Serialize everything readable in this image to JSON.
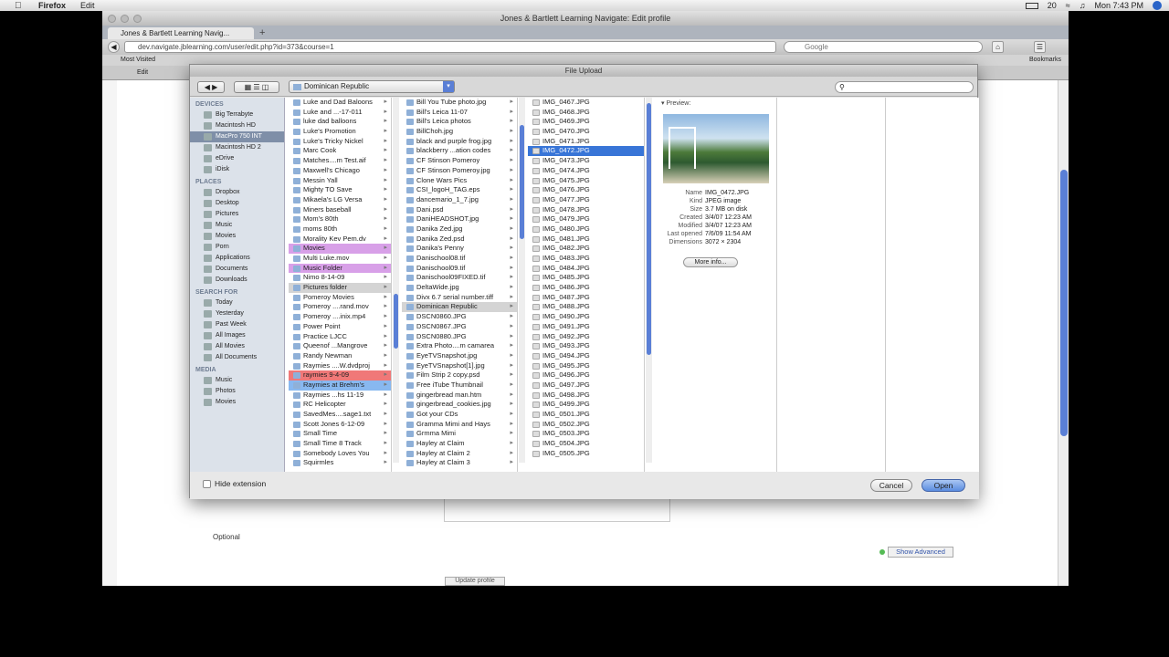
{
  "menubar": {
    "app": "Firefox",
    "items": [
      "Edit"
    ],
    "battery": "20",
    "clock": "Mon 7:43 PM"
  },
  "browser": {
    "window_title": "Jones & Bartlett Learning Navigate: Edit profile",
    "tab_title": "Jones & Bartlett Learning Navig...",
    "url": "dev.navigate.jblearning.com/user/edit.php?id=373&course=1",
    "search_placeholder": "Google",
    "bookmarks_bar": {
      "most_visited": "Most Visited",
      "bookmarks": "Bookmarks"
    },
    "toolbar2": {
      "edit": "Edit"
    }
  },
  "dialog": {
    "title": "File Upload",
    "path": "Dominican Republic",
    "search_value": "",
    "sidebar": {
      "devices_head": "DEVICES",
      "devices": [
        "Big Terrabyte",
        "Macintosh HD",
        "MacPro 750 INT",
        "Macintosh HD 2",
        "eDrive",
        "iDisk"
      ],
      "places_head": "PLACES",
      "places": [
        "Dropbox",
        "Desktop",
        "Pictures",
        "Music",
        "Movies",
        "Porn",
        "Applications",
        "Documents",
        "Downloads"
      ],
      "search_head": "SEARCH FOR",
      "search": [
        "Today",
        "Yesterday",
        "Past Week",
        "All Images",
        "All Movies",
        "All Documents"
      ],
      "media_head": "MEDIA",
      "media": [
        "Music",
        "Photos",
        "Movies"
      ]
    },
    "col1": [
      "Luke and Dad Baloons",
      "Luke and ...-17-011",
      "luke dad balloons",
      "Luke's Promotion",
      "Luke's Tricky Nickel",
      "Marc Cook",
      "Matches....m Test.aif",
      "Maxwell's Chicago",
      "Messin Yall",
      "Mighty TO Save",
      "Mikaela's LG Versa",
      "Miners baseball",
      "Mom's 80th",
      "moms 80th",
      "Morality Kev Pem.dv",
      "Movies",
      "Multi Luke.mov",
      "Music Folder",
      "Nimo 8-14-09",
      "Pictures folder",
      "Pomeroy Movies",
      "Pomeroy ....rand.mov",
      "Pomeroy ....inix.mp4",
      "Power Point",
      "Practice LJCC",
      "Queenof ...Mangrove",
      "Randy Newman",
      "Raymies ....W.dvdproj",
      "raymies 9-4-09",
      "Raymies at Brehm's",
      "Raymies ...hs 11-19",
      "RC Helicopter",
      "SavedMes....sage1.txt",
      "Scott Jones 6-12-09",
      "Small Time",
      "Small Time 8 Track",
      "Somebody Loves You",
      "Squirmles"
    ],
    "col2": [
      "Bill You Tube photo.jpg",
      "Bill's Leica 11-07",
      "Bill's Leica photos",
      "BillChoh.jpg",
      "black and purple frog.jpg",
      "blackberry ...ation codes",
      "CF Stinson Pomeroy",
      "CF Stinson Pomeroy.jpg",
      "Clone Wars Pics",
      "CSI_logoH_TAG.eps",
      "dancemario_1_7.jpg",
      "Dani.psd",
      "DaniHEADSHOT.jpg",
      "Danika Zed.jpg",
      "Danika Zed.psd",
      "Danika's Penny",
      "Danischool08.tif",
      "Danischool09.tif",
      "Danischool09FIXED.tif",
      "DeltaWide.jpg",
      "Divx 6.7 serial number.tiff",
      "Dominican Republic",
      "DSCN0860.JPG",
      "DSCN0867.JPG",
      "DSCN0880.JPG",
      "Extra Photo....m camarea",
      "EyeTVSnapshot.jpg",
      "EyeTVSnapshot[1].jpg",
      "Film Strip 2 copy.psd",
      "Free iTube Thumbnail",
      "gingerbread man.htm",
      "gingerbread_cookies.jpg",
      "Got your CDs",
      "Gramma Mimi and Hays",
      "Grmma Mimi",
      "Hayley at Claim",
      "Hayley at Claim 2",
      "Hayley at Claim 3"
    ],
    "col3": [
      "IMG_0467.JPG",
      "IMG_0468.JPG",
      "IMG_0469.JPG",
      "IMG_0470.JPG",
      "IMG_0471.JPG",
      "IMG_0472.JPG",
      "IMG_0473.JPG",
      "IMG_0474.JPG",
      "IMG_0475.JPG",
      "IMG_0476.JPG",
      "IMG_0477.JPG",
      "IMG_0478.JPG",
      "IMG_0479.JPG",
      "IMG_0480.JPG",
      "IMG_0481.JPG",
      "IMG_0482.JPG",
      "IMG_0483.JPG",
      "IMG_0484.JPG",
      "IMG_0485.JPG",
      "IMG_0486.JPG",
      "IMG_0487.JPG",
      "IMG_0488.JPG",
      "IMG_0490.JPG",
      "IMG_0491.JPG",
      "IMG_0492.JPG",
      "IMG_0493.JPG",
      "IMG_0494.JPG",
      "IMG_0495.JPG",
      "IMG_0496.JPG",
      "IMG_0497.JPG",
      "IMG_0498.JPG",
      "IMG_0499.JPG",
      "IMG_0501.JPG",
      "IMG_0502.JPG",
      "IMG_0503.JPG",
      "IMG_0504.JPG",
      "IMG_0505.JPG"
    ],
    "preview": {
      "head": "Preview:",
      "name_label": "Name",
      "name": "IMG_0472.JPG",
      "kind_label": "Kind",
      "kind": "JPEG image",
      "size_label": "Size",
      "size": "3.7 MB on disk",
      "created_label": "Created",
      "created": "3/4/07 12:23 AM",
      "modified_label": "Modified",
      "modified": "3/4/07 12:23 AM",
      "opened_label": "Last opened",
      "opened": "7/6/09 11:54 AM",
      "dims_label": "Dimensions",
      "dims": "3072 × 2304",
      "more_info": "More info..."
    },
    "hide_extension": "Hide extension",
    "cancel": "Cancel",
    "open": "Open"
  },
  "page": {
    "optional": "Optional",
    "show_advanced": "Show Advanced",
    "update_profile": "Update profile"
  }
}
